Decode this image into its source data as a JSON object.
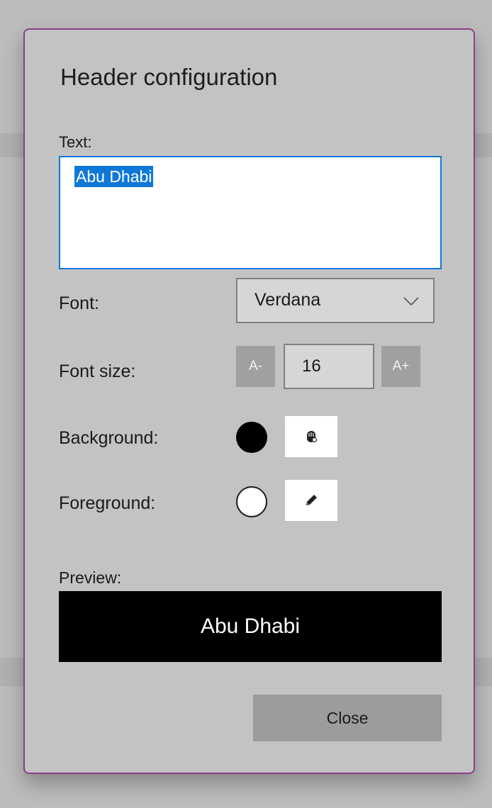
{
  "dialog": {
    "title": "Header configuration",
    "text_label": "Text:",
    "text_value": "Abu Dhabi",
    "font_label": "Font:",
    "font_value": "Verdana",
    "font_size_label": "Font size:",
    "font_size_decrease": "A-",
    "font_size_value": "16",
    "font_size_increase": "A+",
    "background_label": "Background:",
    "background_color": "#000000",
    "background_picker_icon": "hand-picker-icon",
    "foreground_label": "Foreground:",
    "foreground_color": "#ffffff",
    "foreground_picker_icon": "pencil-icon",
    "preview_label": "Preview:",
    "preview_text": "Abu Dhabi",
    "close_label": "Close"
  },
  "colors": {
    "accent": "#0f78d7",
    "dialog_border": "#8a3f86",
    "dialog_background": "#c3c3c3"
  }
}
